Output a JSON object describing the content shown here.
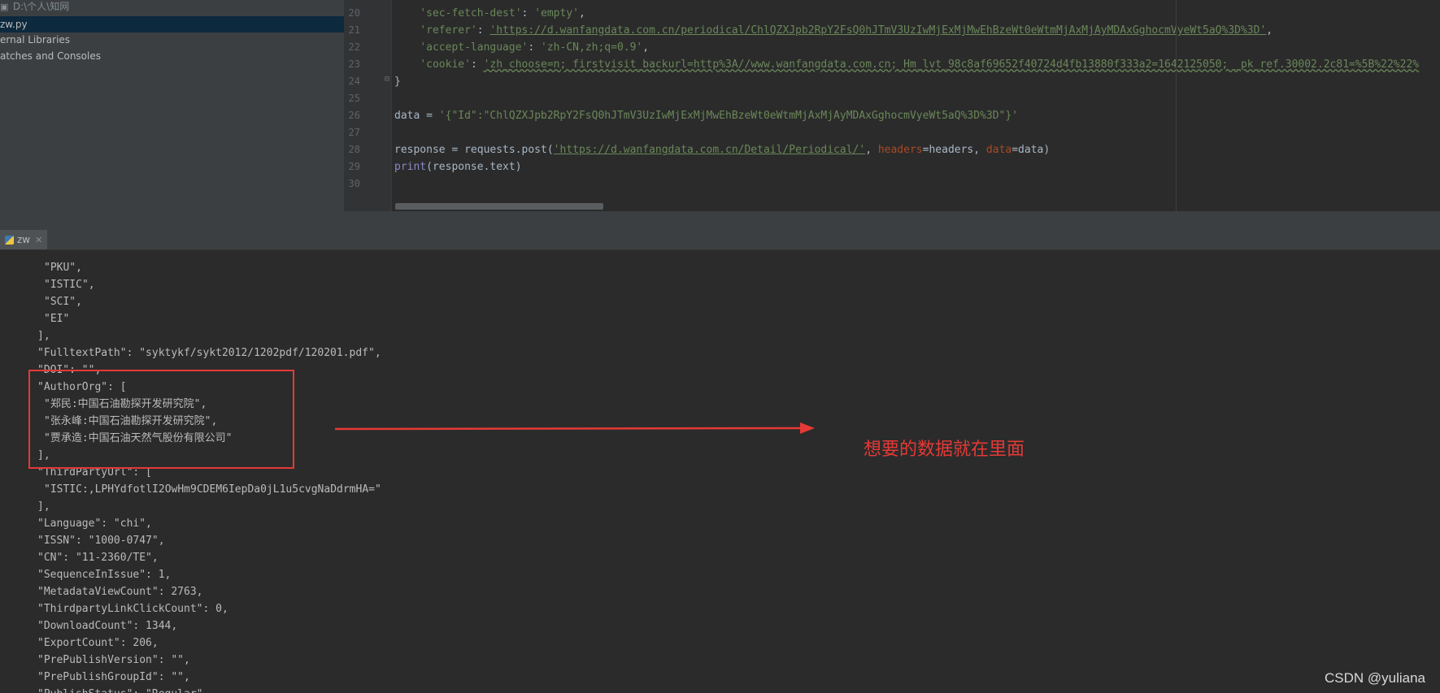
{
  "project": {
    "root_path": "D:\\个人\\知网",
    "items": [
      {
        "label": "zw.py",
        "selected": true
      },
      {
        "label": "ernal Libraries"
      },
      {
        "label": "atches and Consoles"
      }
    ]
  },
  "editor": {
    "line_numbers": [
      "20",
      "21",
      "22",
      "23",
      "24",
      "25",
      "26",
      "27",
      "28",
      "29",
      "30"
    ],
    "code": {
      "l20_key": "'sec-fetch-dest'",
      "l20_val": "'empty'",
      "l21_key": "'referer'",
      "l21_val": "'https://d.wanfangdata.com.cn/periodical/ChlQZXJpb2RpY2FsQ0hJTmV3UzIwMjExMjMwEhBzeWt0eWtmMjAxMjAyMDAxGghocmVyeWt5aQ%3D%3D'",
      "l22_key": "'accept-language'",
      "l22_val": "'zh-CN,zh;q=0.9'",
      "l23_key": "'cookie'",
      "l23_val": "'zh_choose=n; firstvisit_backurl=http%3A//www.wanfangdata.com.cn; Hm_lvt_98c8af69652f40724d4fb13880f333a2=1642125050; _pk_ref.30002.2c81=%5B%22%22%",
      "l24": "}",
      "l26_var": "data = ",
      "l26_val": "'{\"Id\":\"ChlQZXJpb2RpY2FsQ0hJTmV3UzIwMjExMjMwEhBzeWt0eWtmMjAxMjAyMDAxGghocmVyeWt5aQ%3D%3D\"}'",
      "l28_pre": "response = requests.post(",
      "l28_url": "'https://d.wanfangdata.com.cn/Detail/Periodical/'",
      "l28_sep1": ", ",
      "l28_p1": "headers",
      "l28_eq1": "=headers, ",
      "l28_p2": "data",
      "l28_eq2": "=data)",
      "l29_fn": "print",
      "l29_rest": "(response.text)"
    }
  },
  "run_panel": {
    "tab_label": "zw",
    "output_lines": [
      {
        "text": "\"PKU\",",
        "indent": 1
      },
      {
        "text": "\"ISTIC\",",
        "indent": 1
      },
      {
        "text": "\"SCI\",",
        "indent": 1
      },
      {
        "text": "\"EI\"",
        "indent": 1
      },
      {
        "text": "],",
        "indent": 0
      },
      {
        "text": "\"FulltextPath\": \"syktykf/sykt2012/1202pdf/120201.pdf\",",
        "indent": 0
      },
      {
        "text": "\"DOI\": \"\",",
        "indent": 0
      },
      {
        "text": "\"AuthorOrg\": [",
        "indent": 0
      },
      {
        "text": "\"郑民:中国石油勘探开发研究院\",",
        "indent": 1
      },
      {
        "text": "\"张永峰:中国石油勘探开发研究院\",",
        "indent": 1
      },
      {
        "text": "\"贾承造:中国石油天然气股份有限公司\"",
        "indent": 1
      },
      {
        "text": "],",
        "indent": 0
      },
      {
        "text": "\"ThirdPartyUrl\": [",
        "indent": 0
      },
      {
        "text": "\"ISTIC:,LPHYdfotlI2OwHm9CDEM6IepDa0jL1u5cvgNaDdrmHA=\"",
        "indent": 1
      },
      {
        "text": "],",
        "indent": 0
      },
      {
        "text": "\"Language\": \"chi\",",
        "indent": 0
      },
      {
        "text": "\"ISSN\": \"1000-0747\",",
        "indent": 0
      },
      {
        "text": "\"CN\": \"11-2360/TE\",",
        "indent": 0
      },
      {
        "text": "\"SequenceInIssue\": 1,",
        "indent": 0
      },
      {
        "text": "\"MetadataViewCount\": 2763,",
        "indent": 0
      },
      {
        "text": "\"ThirdpartyLinkClickCount\": 0,",
        "indent": 0
      },
      {
        "text": "\"DownloadCount\": 1344,",
        "indent": 0
      },
      {
        "text": "\"ExportCount\": 206,",
        "indent": 0
      },
      {
        "text": "\"PrePublishVersion\": \"\",",
        "indent": 0
      },
      {
        "text": "\"PrePublishGroupId\": \"\",",
        "indent": 0
      },
      {
        "text": "\"PublishStatus\": \"Regular\",",
        "indent": 0
      }
    ]
  },
  "annotation": {
    "text": "想要的数据就在里面",
    "color": "#e53935"
  },
  "watermark": "CSDN @yuliana"
}
